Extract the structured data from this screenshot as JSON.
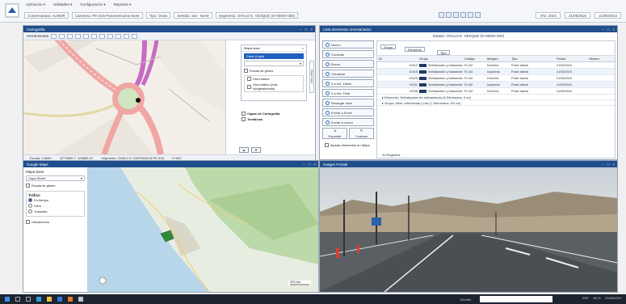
{
  "menu": {
    "items": [
      "Aplicación ▾",
      "Utilidades ▾",
      "Configuración ▾",
      "Reportes ▾"
    ]
  },
  "toolbar": {
    "user_label": "Conservadora: AUNOR",
    "carretera_label": "Carretera: PE-01N Panamericana Norte",
    "tipo_label": "Tipo: Ovalo",
    "sentido_label": "Sentido: Sal · Norte",
    "segmento_label": "Segmento: OVALO E. VESQUE (0+000/0+000)",
    "anio_label": "Año: 2024",
    "fecha_value": "21/06/2024",
    "fecha_value2": "21/06/2024"
  },
  "cartografia": {
    "title": "Cartografía",
    "tools_label": "Herramientas",
    "status_scale": "Escala: 1:8000",
    "status_coords": "-8779800.7 -108885-07",
    "status_segment": "Segmento: OVALO E. ENTRANCIA PE-01N",
    "status_extra": "0+000",
    "mapa_base_title": "Mapa base",
    "mapa_base_selected": "Carto (Light)",
    "mapa_base_option": "",
    "escala_grises": "Escala de grises",
    "trafico_1": "Hora tráfico",
    "trafico_2": "Hora tráfico (más congestionado)",
    "side_legend": "Mapa base",
    "capas_title": "Capas de Cartografía",
    "tematicas": "Temáticas"
  },
  "inventario": {
    "title": "Lista elementos inventariados",
    "subtitle": "Estado: OVALO E. VESQUE (0+000/0+000)",
    "buttons": [
      "Nuevo",
      "Consulta",
      "Borrar",
      "Visualizar",
      "Ir a km. Inicial",
      "Ir a km. Final",
      "Recargar vista",
      "Enviar a Excel",
      "Enviar a correo"
    ],
    "pair_buttons": [
      "Expandir",
      "Contraer"
    ],
    "checkbox_label": "Ajustar elementos en Mapa",
    "group_chip_1": "Grupo",
    "group_chip_2": "Elemento",
    "group_chip_3": "Tipo",
    "columns": [
      "ID",
      "Grupo",
      "Código",
      "Margen",
      "Tipo",
      "Fecha",
      "Observ."
    ],
    "rows": [
      {
        "id": "10012",
        "grupo": "Señalización y balizamiento",
        "codigo": "R-140",
        "margen": "Derecha",
        "tipo": "Poste lateral",
        "fecha": "21/06/2024",
        "obs": ""
      },
      {
        "id": "10016",
        "grupo": "Señalización y balizamiento",
        "codigo": "R-140",
        "margen": "Izquierda",
        "tipo": "Poste lateral",
        "fecha": "21/06/2024",
        "obs": ""
      },
      {
        "id": "10025",
        "grupo": "Señalización y balizamiento",
        "codigo": "R-140",
        "margen": "Derecha",
        "tipo": "Poste lateral",
        "fecha": "21/06/2024",
        "obs": ""
      },
      {
        "id": "10031",
        "grupo": "Señalización y balizamiento",
        "codigo": "R-140",
        "margen": "Izquierda",
        "tipo": "Poste lateral",
        "fecha": "21/06/2024",
        "obs": ""
      },
      {
        "id": "10036",
        "grupo": "Señalización y balizamiento",
        "codigo": "R-140",
        "margen": "Derecha",
        "tipo": "Poste lateral",
        "fecha": "21/06/2024",
        "obs": ""
      }
    ],
    "aggregate_1": "▸ Elemento: Señalización de balizamiento (5 Elementos, 0 ex)",
    "aggregate_2": "▸ Grupo: Mkm. referencias y hito (7 Elementos, 0% ex)",
    "footer": "20 Registros"
  },
  "gmaps": {
    "title": "Google Maps",
    "mapa_base_label": "Mapa base",
    "mapa_base_value": "Capa Street",
    "escala_grises": "Escala de grises",
    "trafico_title": "Tráfico",
    "trafico_options": [
      "En tiempo",
      "Hora",
      "Tranquilo"
    ],
    "leyenda": "Ubicaciones",
    "scale_label": "200 km"
  },
  "video": {
    "title": "Imagen Frontal"
  },
  "taskbar": {
    "search_label": "Escribe",
    "search_placeholder": "",
    "lang": "ESP",
    "time": "16:21",
    "date": "21/06/2024"
  },
  "colors": {
    "header_blue": "#1f4e8c",
    "accent": "#1f5fbf",
    "green_region": "#2e8b3a"
  }
}
